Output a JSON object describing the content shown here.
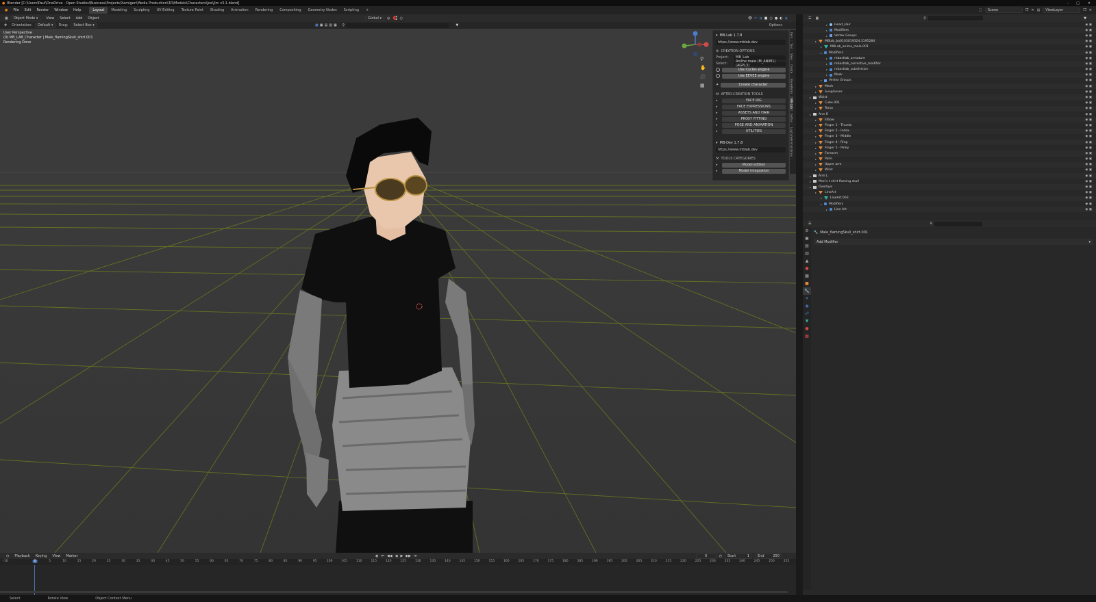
{
  "window": {
    "title": "Blender [C:\\Users\\Paul\\OneDrive - Open Studios\\Business\\Projects\\Xamigen\\Media Production\\3D\\Models\\Characters\\Joe\\Jim v3.1.blend]"
  },
  "menu": [
    "File",
    "Edit",
    "Render",
    "Window",
    "Help"
  ],
  "workspaces": [
    "Layout",
    "Modeling",
    "Sculpting",
    "UV Editing",
    "Texture Paint",
    "Shading",
    "Animation",
    "Rendering",
    "Compositing",
    "Geometry Nodes",
    "Scripting"
  ],
  "active_workspace": "Layout",
  "scene": {
    "name": "Scene",
    "view_layer": "ViewLayer"
  },
  "viewport_header": {
    "mode": "Object Mode",
    "menus": [
      "View",
      "Select",
      "Add",
      "Object"
    ],
    "transform": "Global",
    "orientation_label": "Orientation:",
    "orientation_value": "Default",
    "drag_label": "Drag:",
    "drag_value": "Select Box",
    "options": "Options"
  },
  "viewport_info": {
    "line1": "User Perspective",
    "line2": "(0) MB_LAB_Character | Male_flamingSkull_shirt.001",
    "line3": "Rendering Done"
  },
  "mblab_panel": {
    "title": "MB-Lab 1.7.8",
    "url": "https://www.mblab.dev",
    "creation_options": "CREATION OPTIONS",
    "project_label": "Project:",
    "project_value": "MB_Lab",
    "select_label": "Select:",
    "select_value": "Anime male (M_ANIM1) (AGPL3)",
    "use_cycles": "Use Cycles engine",
    "use_eevee": "Use EEVEE engine",
    "create_character": "Create character",
    "after_creation": "AFTER-CREATION TOOLS",
    "tools": [
      "FACE RIG",
      "FACE EXPRESSIONS",
      "ASSETS AND HAIR",
      "PROXY FITTING",
      "POSE AND ANIMATION",
      "UTILITIES"
    ],
    "dev_title": "MB-Dev 1.7.8",
    "dev_url": "https://www.mblab.dev",
    "tools_categories": "TOOLS CATEGORIES",
    "dev_tools": [
      "Model edition",
      "Model integration"
    ]
  },
  "side_tabs": [
    "Item",
    "Tool",
    "View",
    "Create",
    "BoneWorks",
    "MB-Lab",
    "botGui",
    "LogCoreAnimaLibrary"
  ],
  "timeline": {
    "menus": [
      "Playback",
      "Keying",
      "View",
      "Marker"
    ],
    "current_frame": "0",
    "start_label": "Start",
    "start": "1",
    "end_label": "End",
    "end": "250",
    "ticks": [
      "-10",
      "0",
      "5",
      "10",
      "15",
      "20",
      "25",
      "30",
      "35",
      "40",
      "45",
      "50",
      "55",
      "60",
      "65",
      "70",
      "75",
      "80",
      "85",
      "90",
      "95",
      "100",
      "105",
      "110",
      "115",
      "120",
      "125",
      "130",
      "135",
      "140",
      "145",
      "150",
      "155",
      "160",
      "165",
      "170",
      "175",
      "180",
      "185",
      "190",
      "195",
      "200",
      "205",
      "210",
      "215",
      "220",
      "225",
      "230",
      "235",
      "240",
      "245",
      "250",
      "255"
    ]
  },
  "status_bar": [
    "Select",
    "Rotate View",
    "Object Context Menu"
  ],
  "outliner": {
    "rows": [
      {
        "indent": 3,
        "icon": "bone",
        "label": "Head_Hair"
      },
      {
        "indent": 3,
        "icon": "wr",
        "label": "Modifiers"
      },
      {
        "indent": 3,
        "icon": "grp",
        "label": "Vertex Groups"
      },
      {
        "indent": 1,
        "icon": "tri",
        "label": "MBlab_bo0103019324.3195284"
      },
      {
        "indent": 2,
        "icon": "mesh",
        "label": "MBLab_anime_male.001"
      },
      {
        "indent": 2,
        "icon": "wr",
        "label": "Modifiers"
      },
      {
        "indent": 3,
        "icon": "wr",
        "label": "mbastlab_armature"
      },
      {
        "indent": 3,
        "icon": "wr",
        "label": "mbastlab_corrective_modifier"
      },
      {
        "indent": 3,
        "icon": "wr",
        "label": "mbastlab_subdivision"
      },
      {
        "indent": 3,
        "icon": "wr",
        "label": "Mask"
      },
      {
        "indent": 2,
        "icon": "grp",
        "label": "Vertex Groups"
      },
      {
        "indent": 1,
        "icon": "tri",
        "label": "Mesh"
      },
      {
        "indent": 1,
        "icon": "tri",
        "label": "Sunglasses"
      },
      {
        "indent": 0,
        "icon": "coll",
        "label": "Waist"
      },
      {
        "indent": 1,
        "icon": "tri",
        "label": "Cube.001"
      },
      {
        "indent": 1,
        "icon": "tri",
        "label": "Torso"
      },
      {
        "indent": 0,
        "icon": "coll",
        "label": "Arm R"
      },
      {
        "indent": 1,
        "icon": "tri",
        "label": "Elbow"
      },
      {
        "indent": 1,
        "icon": "tri",
        "label": "Finger 1 - Thumb"
      },
      {
        "indent": 1,
        "icon": "tri",
        "label": "Finger 2 - Index"
      },
      {
        "indent": 1,
        "icon": "tri",
        "label": "Finger 3 - Middle"
      },
      {
        "indent": 1,
        "icon": "tri",
        "label": "Finger 4 - Ring"
      },
      {
        "indent": 1,
        "icon": "tri",
        "label": "Finger 5 - Pinky"
      },
      {
        "indent": 1,
        "icon": "tri",
        "label": "Forearm"
      },
      {
        "indent": 1,
        "icon": "tri",
        "label": "Palm"
      },
      {
        "indent": 1,
        "icon": "tri",
        "label": "Upper arm"
      },
      {
        "indent": 1,
        "icon": "tri",
        "label": "Wrist"
      },
      {
        "indent": 0,
        "icon": "coll",
        "label": "Arm L"
      },
      {
        "indent": 0,
        "icon": "coll",
        "label": "Men's t shirt flaming skull"
      },
      {
        "indent": 0,
        "icon": "coll",
        "label": "Overlays"
      },
      {
        "indent": 1,
        "icon": "tri",
        "label": "LineArt"
      },
      {
        "indent": 2,
        "icon": "mesh",
        "label": "LineArt.003"
      },
      {
        "indent": 2,
        "icon": "wr",
        "label": "Modifiers"
      },
      {
        "indent": 3,
        "icon": "wr",
        "label": "Line Art"
      }
    ]
  },
  "properties": {
    "object_name": "Male_flamingSkull_shirt.001",
    "add_modifier": "Add Modifier"
  },
  "colors": {
    "accent": "#4772b3",
    "grid_line": "#6f7a1e",
    "outliner_tri": "#e08a3c"
  }
}
